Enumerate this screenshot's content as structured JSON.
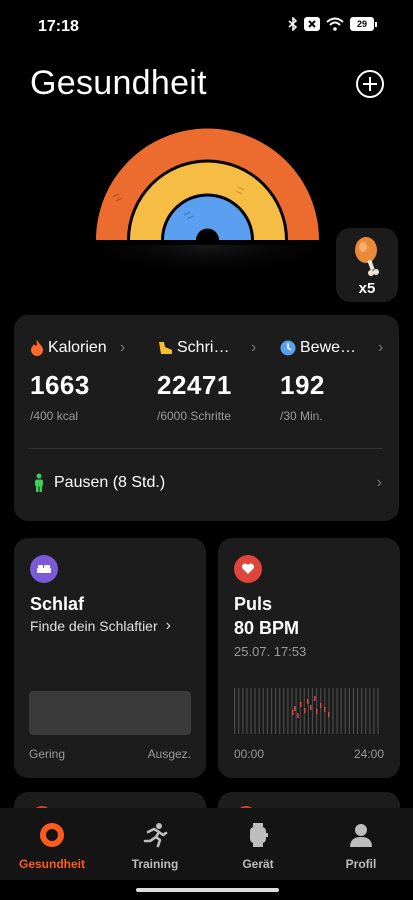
{
  "status": {
    "time": "17:18",
    "battery": "29"
  },
  "header": {
    "title": "Gesundheit"
  },
  "reward": {
    "count": "x5"
  },
  "stats": [
    {
      "label": "Kalorien",
      "value": "1663",
      "sub": "/400 kcal",
      "icon": "flame-icon",
      "color": "#ff6a2b"
    },
    {
      "label": "Schri…",
      "value": "22471",
      "sub": "/6000 Schritte",
      "icon": "shoe-icon",
      "color": "#f5c030"
    },
    {
      "label": "Bewe…",
      "value": "192",
      "sub": "/30 Min.",
      "icon": "clock-icon",
      "color": "#5aa0f0"
    }
  ],
  "pause": {
    "label": "Pausen (8 Std.)"
  },
  "sleep": {
    "title": "Schlaf",
    "subtitle": "Finde dein Schlaftier",
    "low": "Gering",
    "high": "Ausgez."
  },
  "pulse": {
    "title": "Puls",
    "value": "80 BPM",
    "datetime": "25.07. 17:53",
    "start": "00:00",
    "end": "24:00"
  },
  "nav": [
    {
      "label": "Gesundheit",
      "icon": "health-ring-icon",
      "active": true
    },
    {
      "label": "Training",
      "icon": "runner-icon",
      "active": false
    },
    {
      "label": "Gerät",
      "icon": "watch-icon",
      "active": false
    },
    {
      "label": "Profil",
      "icon": "person-icon",
      "active": false
    }
  ],
  "colors": {
    "accent": "#ff5a1f",
    "ring_outer": "#ec6b2e",
    "ring_mid": "#f5bd44",
    "ring_inner": "#5b9ff0"
  }
}
